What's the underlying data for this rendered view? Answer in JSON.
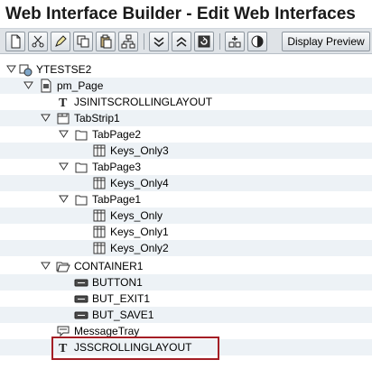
{
  "window": {
    "title": "Web Interface Builder - Edit Web Interfaces"
  },
  "toolbar": {
    "display_preview_label": "Display Preview"
  },
  "tree": {
    "root": {
      "label": "YTESTSE2"
    },
    "page": {
      "label": "pm_Page"
    },
    "jsinit": {
      "label": "JSINITSCROLLINGLAYOUT"
    },
    "tabstrip": {
      "label": "TabStrip1"
    },
    "tabpage2": {
      "label": "TabPage2"
    },
    "keys_only3": {
      "label": "Keys_Only3"
    },
    "tabpage3": {
      "label": "TabPage3"
    },
    "keys_only4": {
      "label": "Keys_Only4"
    },
    "tabpage1": {
      "label": "TabPage1"
    },
    "keys_only": {
      "label": "Keys_Only"
    },
    "keys_only1": {
      "label": "Keys_Only1"
    },
    "keys_only2": {
      "label": "Keys_Only2"
    },
    "container1": {
      "label": "CONTAINER1"
    },
    "button1": {
      "label": "BUTTON1"
    },
    "but_exit1": {
      "label": "BUT_EXIT1"
    },
    "but_save1": {
      "label": "BUT_SAVE1"
    },
    "messagetray": {
      "label": "MessageTray"
    },
    "jsscrolling": {
      "label": "JSSCROLLINGLAYOUT"
    }
  },
  "colors": {
    "highlight_border": "#a41e25",
    "row_shade": "#edf2f6",
    "toolbar_bg": "#dfe3e7"
  }
}
